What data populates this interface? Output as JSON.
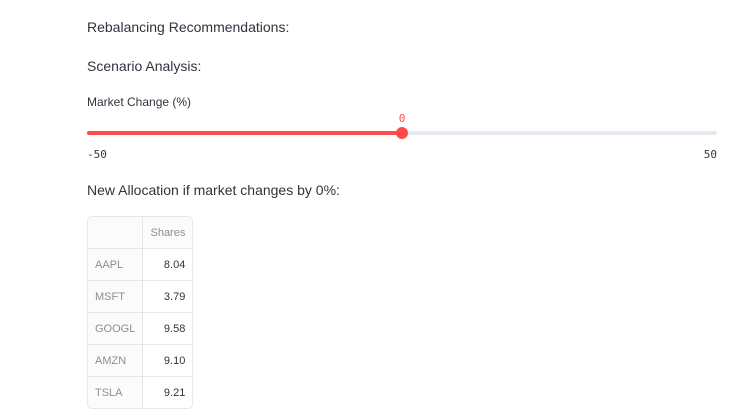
{
  "rebalancing": {
    "heading": "Rebalancing Recommendations:"
  },
  "scenario": {
    "heading": "Scenario Analysis:"
  },
  "slider": {
    "label": "Market Change (%)",
    "value": 0,
    "value_text": "0",
    "min": -50,
    "min_text": "-50",
    "max": 50,
    "max_text": "50",
    "accent_color": "#ff4b4b",
    "track_color": "#e6eaf1"
  },
  "allocation": {
    "heading": "New Allocation if market changes by 0%:",
    "table": {
      "column_header": "Shares",
      "rows": [
        {
          "ticker": "AAPL",
          "shares": "8.04"
        },
        {
          "ticker": "MSFT",
          "shares": "3.79"
        },
        {
          "ticker": "GOOGL",
          "shares": "9.58"
        },
        {
          "ticker": "AMZN",
          "shares": "9.10"
        },
        {
          "ticker": "TSLA",
          "shares": "9.21"
        }
      ]
    }
  }
}
